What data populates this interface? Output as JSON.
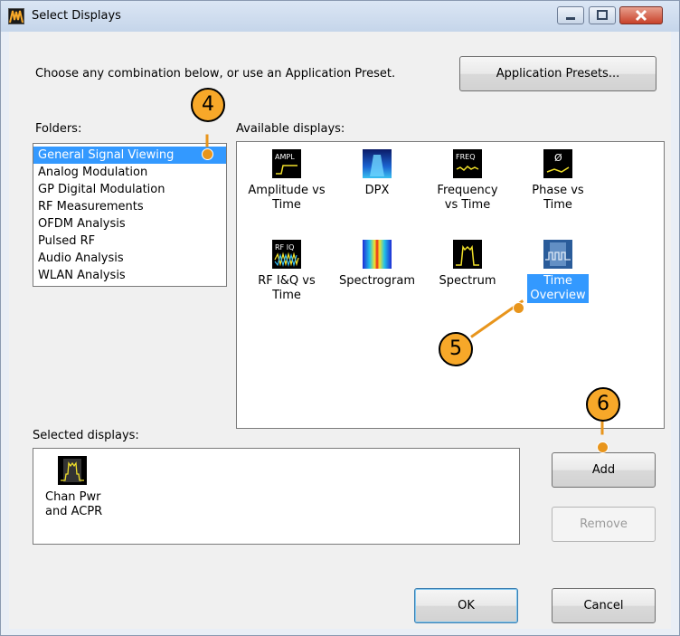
{
  "window": {
    "title": "Select Displays"
  },
  "intro": {
    "text": "Choose any combination below, or use an Application Preset."
  },
  "buttons": {
    "presets": "Application Presets...",
    "add": "Add",
    "remove": "Remove",
    "ok": "OK",
    "cancel": "Cancel"
  },
  "folders": {
    "label": "Folders:",
    "items": [
      "General Signal Viewing",
      "Analog Modulation",
      "GP Digital Modulation",
      "RF Measurements",
      "OFDM Analysis",
      "Pulsed RF",
      "Audio Analysis",
      "WLAN Analysis"
    ],
    "selected": "General Signal Viewing"
  },
  "available": {
    "label": "Available displays:",
    "items": [
      {
        "line1": "Amplitude vs",
        "line2": "Time",
        "icon": "amplitude-icon",
        "icon_text": "AMPL"
      },
      {
        "line1": "DPX",
        "line2": "",
        "icon": "dpx-icon"
      },
      {
        "line1": "Frequency",
        "line2": "vs Time",
        "icon": "frequency-icon",
        "icon_text": "FREQ"
      },
      {
        "line1": "Phase vs",
        "line2": "Time",
        "icon": "phase-icon",
        "icon_text": "Ø"
      },
      {
        "line1": "RF I&Q vs",
        "line2": "Time",
        "icon": "rf-iq-icon",
        "icon_text": "RF IQ"
      },
      {
        "line1": "Spectrogram",
        "line2": "",
        "icon": "spectrogram-icon"
      },
      {
        "line1": "Spectrum",
        "line2": "",
        "icon": "spectrum-icon"
      },
      {
        "line1": "Time",
        "line2": "Overview",
        "icon": "time-overview-icon",
        "selected": true
      }
    ]
  },
  "selected_displays": {
    "label": "Selected displays:",
    "items": [
      {
        "line1": "Chan Pwr",
        "line2": "and ACPR",
        "icon": "chan-pwr-icon"
      }
    ]
  },
  "callouts": [
    "4",
    "5",
    "6"
  ],
  "colors": {
    "selection": "#3399ff",
    "callout": "#f7a829"
  }
}
